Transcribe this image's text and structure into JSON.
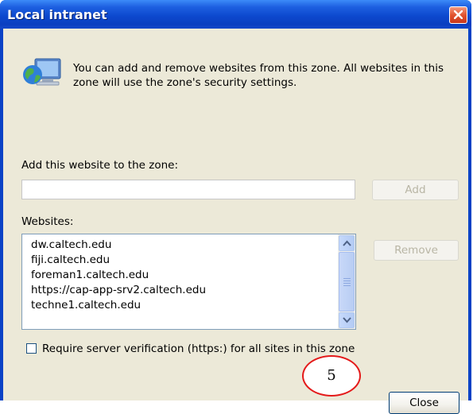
{
  "window": {
    "title": "Local intranet"
  },
  "info": {
    "text": "You can add and remove websites from this zone. All websites in this zone will use the zone's security settings."
  },
  "add_section": {
    "label": "Add this website to the zone:",
    "input_value": "",
    "add_label": "Add"
  },
  "websites": {
    "label": "Websites:",
    "items": [
      "dw.caltech.edu",
      "fiji.caltech.edu",
      "foreman1.caltech.edu",
      "https://cap-app-srv2.caltech.edu",
      "techne1.caltech.edu"
    ],
    "remove_label": "Remove"
  },
  "verification": {
    "label": "Require server verification (https:) for all sites in this zone",
    "checked": false
  },
  "footer": {
    "close_label": "Close"
  },
  "annotation": {
    "label": "5",
    "color": "#e41a1a"
  },
  "icons": {
    "title_close": "close-icon",
    "info": "network-computer-icon",
    "scroll_up": "chevron-up-icon",
    "scroll_down": "chevron-down-icon"
  }
}
